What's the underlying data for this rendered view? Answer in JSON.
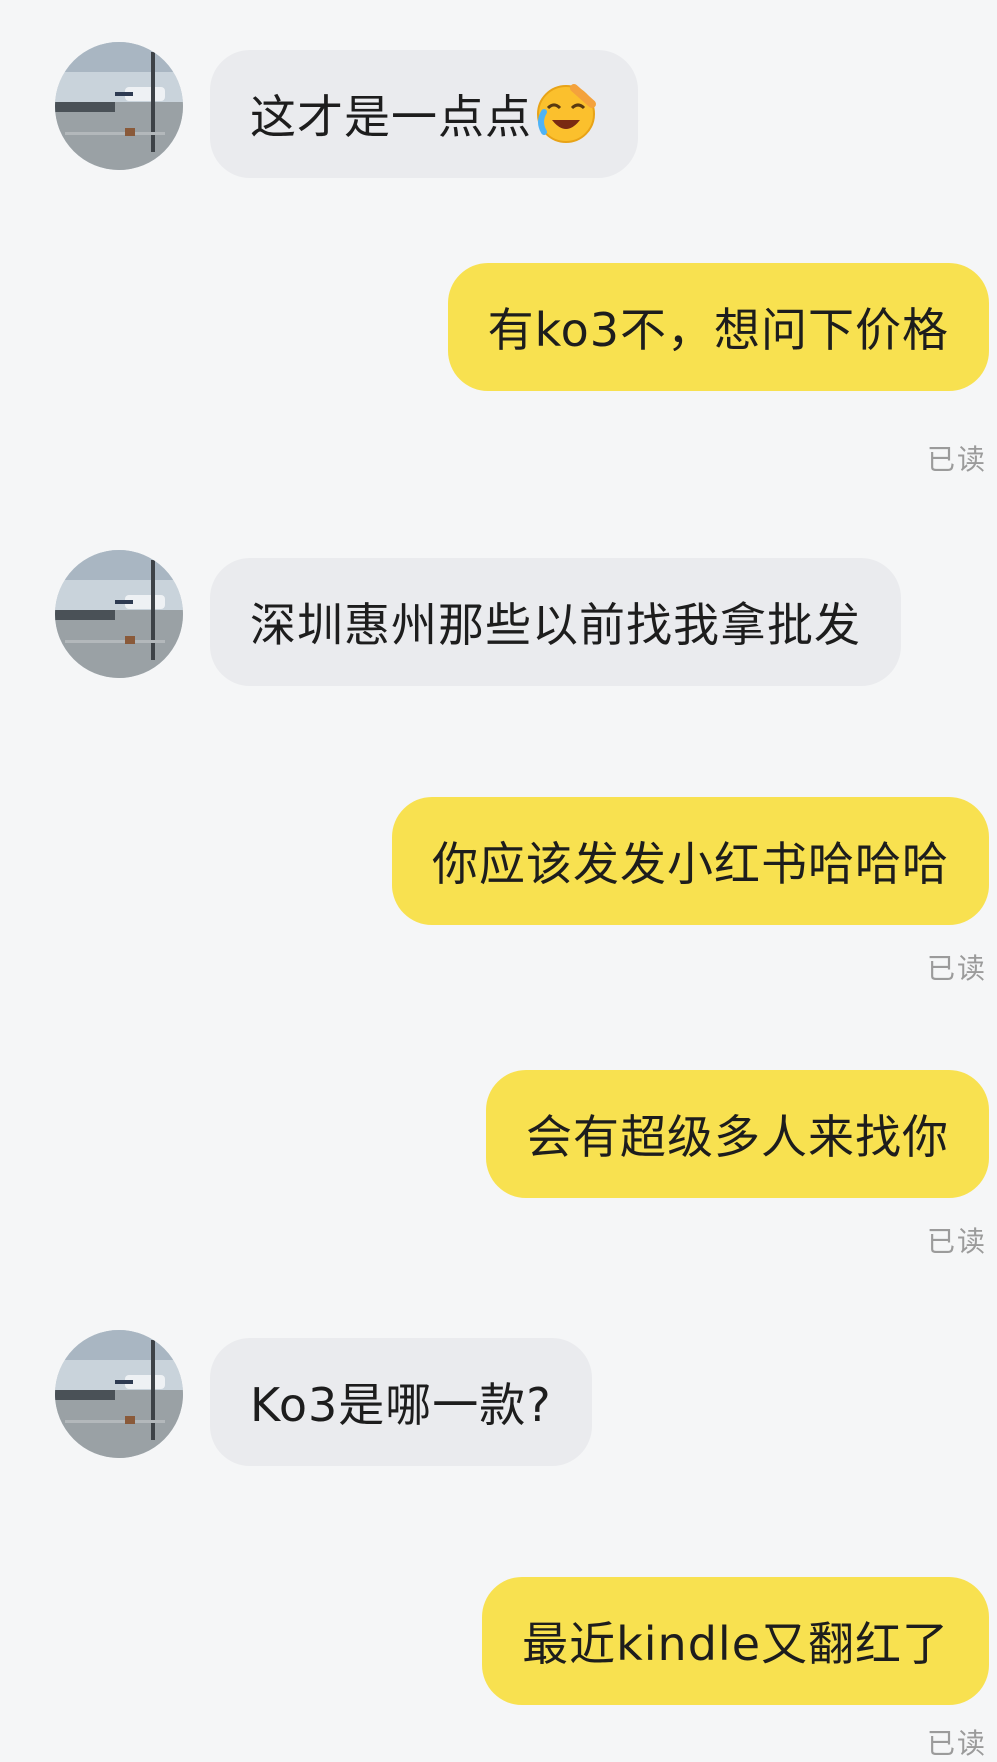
{
  "messages": [
    {
      "side": "incoming",
      "text": "这才是一点点",
      "emoji": "crying-laughing-emoji"
    },
    {
      "side": "outgoing",
      "text": "有ko3不，想问下价格",
      "status": "已读"
    },
    {
      "side": "incoming",
      "text": "深圳惠州那些以前找我拿批发"
    },
    {
      "side": "outgoing",
      "text": "你应该发发小红书哈哈哈",
      "status": "已读"
    },
    {
      "side": "outgoing",
      "text": "会有超级多人来找你",
      "status": "已读"
    },
    {
      "side": "incoming",
      "text": "Ko3是哪一款?"
    },
    {
      "side": "outgoing",
      "text": "最近kindle又翻红了",
      "status": "已读"
    }
  ],
  "colors": {
    "background": "#F5F6F7",
    "incoming_bubble": "#EAEBEE",
    "outgoing_bubble": "#F8E150",
    "text": "#1D1D1D",
    "read_status": "#9B9B9B"
  },
  "icons": {
    "avatar": "airport-photo-avatar",
    "emoji": "crying-laughing-emoji"
  }
}
